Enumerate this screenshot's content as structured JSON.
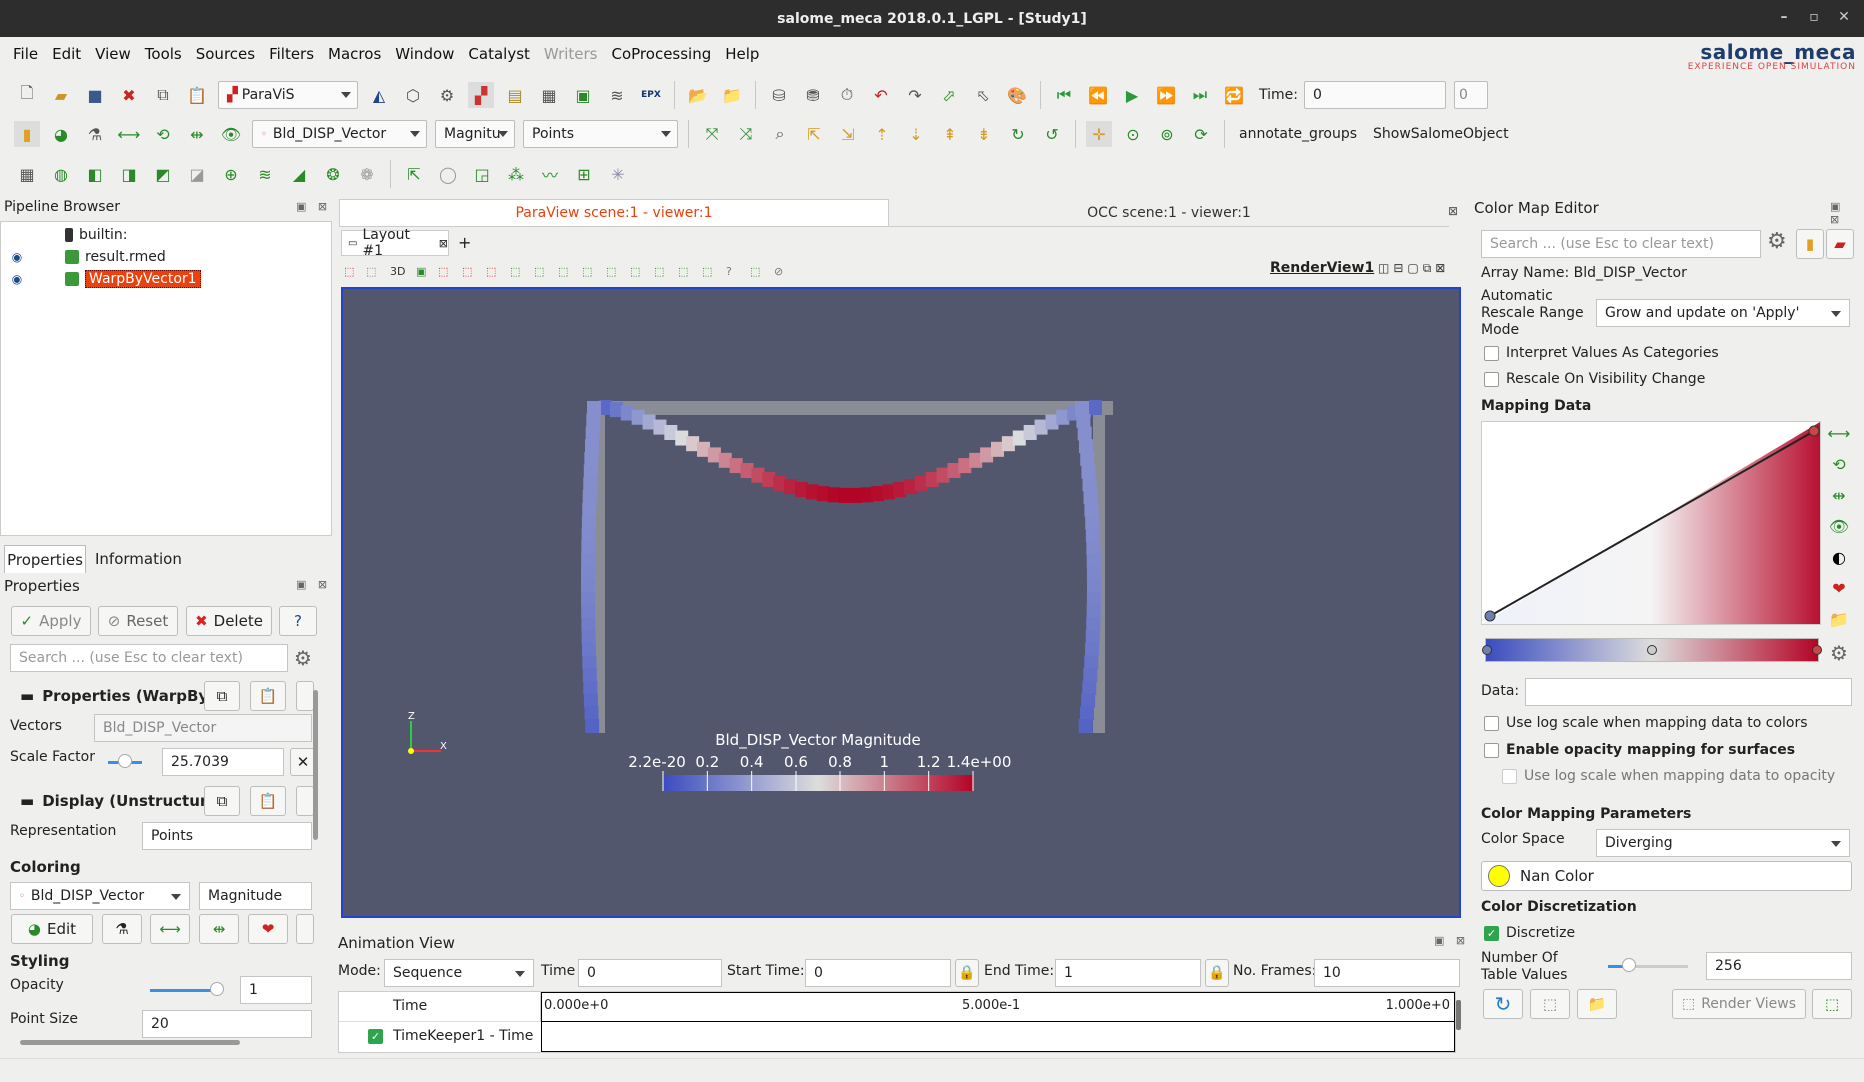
{
  "window": {
    "title": "salome_meca 2018.0.1_LGPL - [Study1]"
  },
  "menu": [
    "File",
    "Edit",
    "View",
    "Tools",
    "Sources",
    "Filters",
    "Macros",
    "Window",
    "Catalyst",
    "Writers",
    "CoProcessing",
    "Help"
  ],
  "logo": {
    "name": "salome_meca",
    "tagline": "EXPERIENCE OPEN SIMULATION"
  },
  "toolbar": {
    "module": "ParaViS",
    "time_label": "Time:",
    "time_value": "0",
    "time_index": "0",
    "array": "Bld_DISP_Vector",
    "component": "Magnitu",
    "representation": "Points",
    "annotate": "annotate_groups",
    "show_salome": "ShowSalomeObject"
  },
  "pipeline": {
    "title": "Pipeline Browser",
    "items": [
      "builtin:",
      "result.rmed",
      "WarpByVector1"
    ]
  },
  "tabs": {
    "properties": "Properties",
    "information": "Information"
  },
  "properties": {
    "title": "Properties",
    "apply": "Apply",
    "reset": "Reset",
    "delete": "Delete",
    "help": "?",
    "search_placeholder": "Search ... (use Esc to clear text)",
    "section1": "Properties (WarpBy'",
    "vectors_label": "Vectors",
    "vectors_value": "Bld_DISP_Vector",
    "scale_label": "Scale Factor",
    "scale_value": "25.7039",
    "section2": "Display (Unstructure",
    "repr_label": "Representation",
    "repr_value": "Points",
    "coloring": "Coloring",
    "color_array": "Bld_DISP_Vector",
    "color_comp": "Magnitude",
    "edit": "Edit",
    "styling": "Styling",
    "opacity_label": "Opacity",
    "opacity_value": "1",
    "pointsize_label": "Point Size",
    "pointsize_value": "20"
  },
  "viewtabs": {
    "paraview": "ParaView scene:1 - viewer:1",
    "occ": "OCC scene:1 - viewer:1"
  },
  "layout": {
    "tab": "Layout #1",
    "plus": "+",
    "view": "RenderView1",
    "btn3d": "3D"
  },
  "legend": {
    "title": "Bld_DISP_Vector Magnitude",
    "ticks": [
      "2.2e-20",
      "0.2",
      "0.4",
      "0.6",
      "0.8",
      "1",
      "1.2",
      "1.4e+00"
    ]
  },
  "axes": {
    "z": "Z",
    "x": "X"
  },
  "animation": {
    "title": "Animation View",
    "mode_label": "Mode:",
    "mode_value": "Sequence",
    "time_label": "Time",
    "time_value": "0",
    "start_label": "Start Time:",
    "start_value": "0",
    "end_label": "End Time:",
    "end_value": "1",
    "frames_label": "No. Frames:",
    "frames_value": "10",
    "row1": "Time",
    "row2": "TimeKeeper1 - Time",
    "t0": "0.000e+0",
    "t1": "5.000e-1",
    "t2": "1.000e+0"
  },
  "colormap": {
    "title": "Color Map Editor",
    "search_placeholder": "Search ... (use Esc to clear text)",
    "array_name": "Array Name: Bld_DISP_Vector",
    "rescale_label": "Automatic\nRescale Range\nMode",
    "rescale_value": "Grow and update on 'Apply'",
    "interpret": "Interpret Values As Categories",
    "rescale_vis": "Rescale On Visibility Change",
    "mapping": "Mapping Data",
    "data_label": "Data:",
    "log_scale": "Use log scale when mapping data to colors",
    "opacity_map": "Enable opacity mapping for surfaces",
    "log_opacity": "Use log scale when mapping data to opacity",
    "params": "Color Mapping Parameters",
    "space_label": "Color Space",
    "space_value": "Diverging",
    "nan": "Nan Color",
    "discretization": "Color Discretization",
    "discretize": "Discretize",
    "table_label": "Number Of\nTable Values",
    "table_value": "256",
    "render_views": "Render Views",
    "colors": {
      "low": "#3b4cc0",
      "mid": "#dddddd",
      "high": "#b40426",
      "nan": "#ffff00"
    }
  }
}
